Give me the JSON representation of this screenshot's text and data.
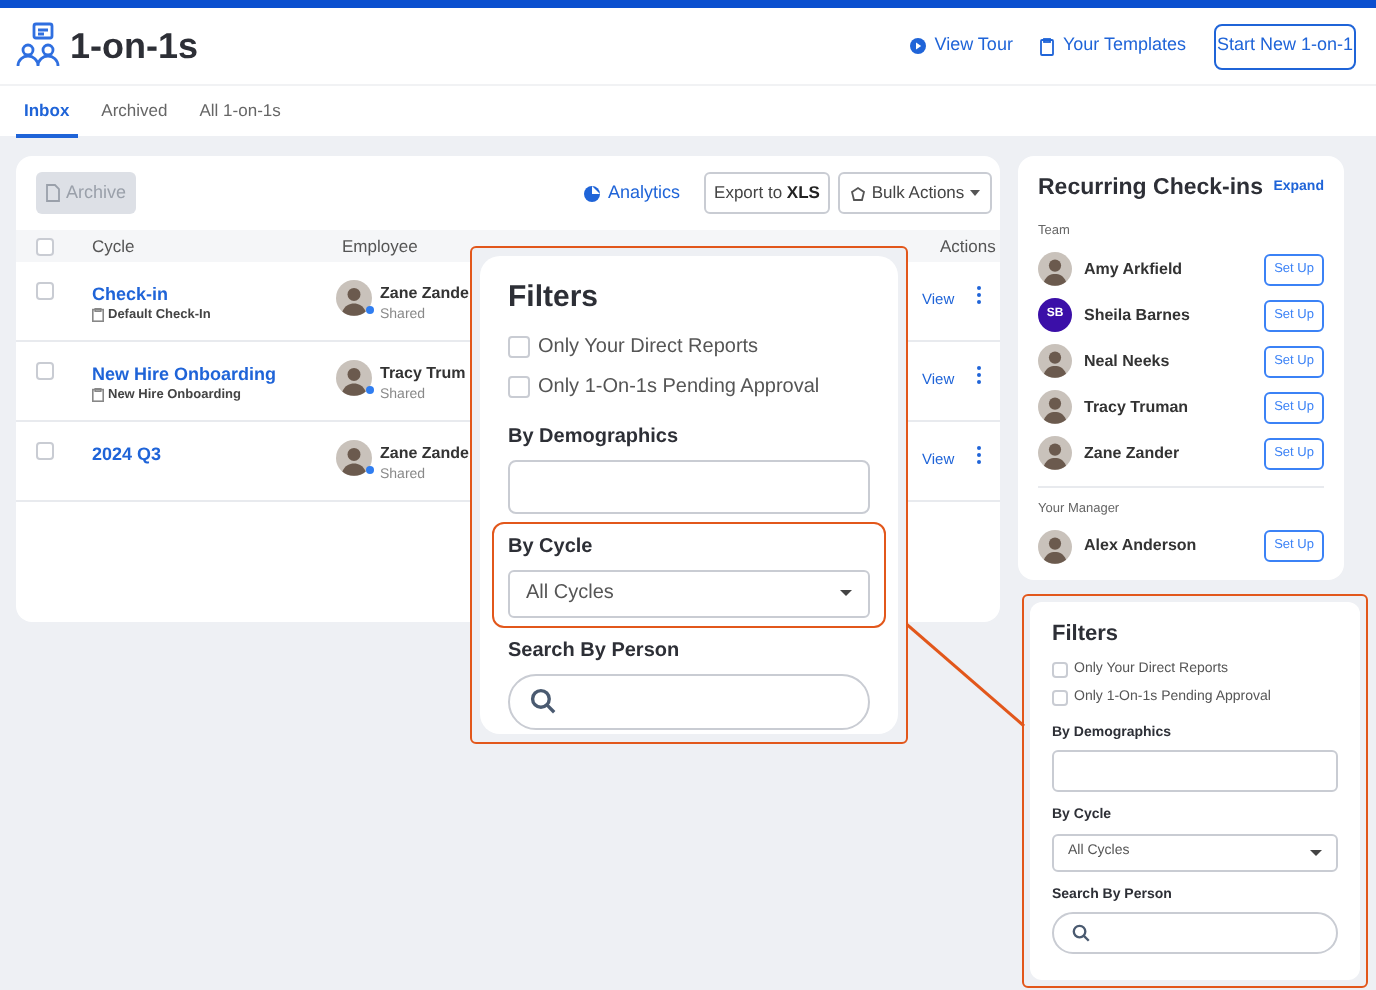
{
  "header": {
    "title": "1-on-1s",
    "links": [
      "View Tour",
      "Your Templates"
    ],
    "primary_button": "Start New 1-on-1"
  },
  "tabs": [
    {
      "label": "Inbox",
      "selected": true
    },
    {
      "label": "Archived",
      "selected": false
    },
    {
      "label": "All 1-on-1s",
      "selected": false
    }
  ],
  "toolbar": {
    "archive_button": {
      "label": "Archive",
      "disabled": true
    },
    "analytics": "Analytics",
    "export_button": {
      "text": "Export to ",
      "bold": "XLS"
    },
    "bulk_button": "Bulk Actions"
  },
  "table": {
    "select_all_checked": false,
    "columns": [
      "Cycle",
      "Employee",
      "Actions"
    ],
    "rows": [
      {
        "cycle": "Check-in",
        "template": "Default Check-In",
        "employee": "Zane Zande",
        "status": "Shared",
        "action": "View",
        "checked": false
      },
      {
        "cycle": "New Hire Onboarding",
        "template": "New Hire Onboarding",
        "employee": "Tracy Trum",
        "status": "Shared",
        "action": "View",
        "checked": false
      },
      {
        "cycle": "2024 Q3",
        "employee": "Zane Zande",
        "status": "Shared",
        "action": "View",
        "checked": false
      }
    ]
  },
  "recurring": {
    "title": "Recurring Check-ins",
    "expand": "Expand",
    "sections": [
      {
        "label": "Team",
        "people": [
          {
            "name": "Amy Arkfield",
            "avatar": {
              "kind": "photo"
            },
            "button": "Set Up"
          },
          {
            "name": "Sheila Barnes",
            "avatar": {
              "kind": "initials",
              "initials": "SB",
              "color": "#3b0fa8"
            },
            "button": "Set Up"
          },
          {
            "name": "Neal Neeks",
            "avatar": {
              "kind": "photo"
            },
            "button": "Set Up"
          },
          {
            "name": "Tracy Truman",
            "avatar": {
              "kind": "photo"
            },
            "button": "Set Up"
          },
          {
            "name": "Zane Zander",
            "avatar": {
              "kind": "photo"
            },
            "button": "Set Up"
          }
        ]
      },
      {
        "label": "Your Manager",
        "people": [
          {
            "name": "Alex Anderson",
            "avatar": {
              "kind": "photo"
            },
            "button": "Set Up"
          }
        ]
      }
    ]
  },
  "filters_callout": {
    "title": "Filters",
    "checkboxes": [
      {
        "label": "Only Your Direct Reports",
        "checked": false
      },
      {
        "label": "Only 1-On-1s Pending Approval",
        "checked": false
      }
    ],
    "demographics_label": "By Demographics",
    "cycle_label": "By Cycle",
    "cycle_value": "All Cycles",
    "person_label": "Search By Person"
  },
  "filters_panel": {
    "title": "Filters",
    "checkboxes": [
      {
        "label": "Only Your Direct Reports",
        "checked": false
      },
      {
        "label": "Only 1-On-1s Pending Approval",
        "checked": false
      }
    ],
    "demographics_label": "By Demographics",
    "cycle_label": "By Cycle",
    "cycle_value": "All Cycles",
    "person_label": "Search By Person"
  }
}
